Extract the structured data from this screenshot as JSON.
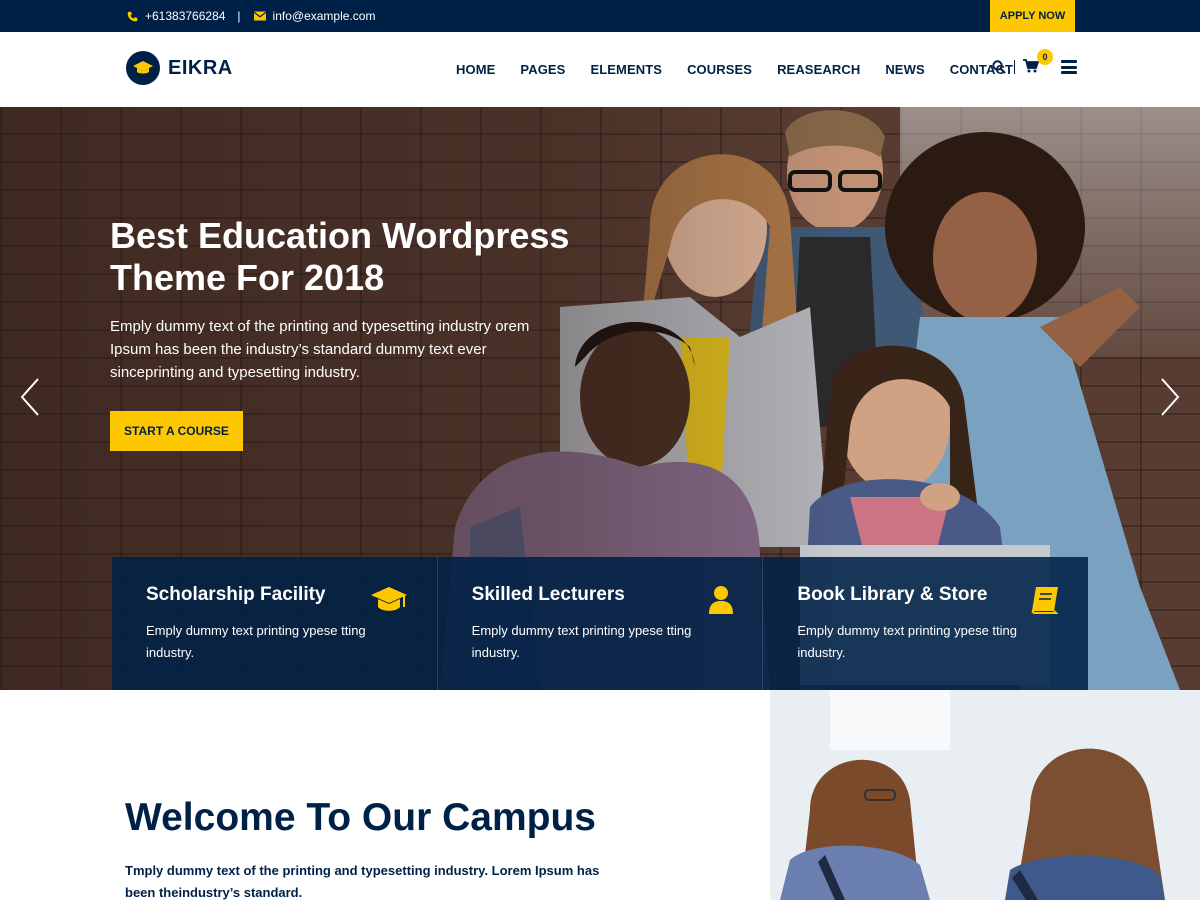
{
  "topbar": {
    "phone": "+61383766284",
    "separator": "|",
    "email": "info@example.com",
    "apply_label": "APPLY NOW"
  },
  "header": {
    "logo_text": "EIKRA",
    "nav": [
      "HOME",
      "PAGES",
      "ELEMENTS",
      "COURSES",
      "REASEARCH",
      "NEWS",
      "CONTACT"
    ],
    "cart_count": "0",
    "tool_separator": "|"
  },
  "hero": {
    "title_line1": "Best Education Wordpress",
    "title_line2": "Theme For 2018",
    "text": "Emply dummy text of the printing and typesetting industry orem Ipsum has been the industry’s standard dummy text ever sinceprinting and typesetting industry.",
    "button_label": "START A COURSE"
  },
  "features": [
    {
      "title": "Scholarship Facility",
      "text": "Emply dummy text printing ypese tting industry.",
      "icon": "graduation-cap-icon"
    },
    {
      "title": "Skilled Lecturers",
      "text": "Emply dummy text printing ypese tting industry.",
      "icon": "user-icon"
    },
    {
      "title": "Book Library & Store",
      "text": "Emply dummy text printing ypese tting industry.",
      "icon": "book-icon"
    }
  ],
  "welcome": {
    "title": "Welcome To Our Campus",
    "text": "Tmply dummy text of the printing and typesetting industry. Lorem Ipsum has been theindustry’s standard."
  },
  "colors": {
    "navy": "#002147",
    "yellow": "#fdc800"
  }
}
